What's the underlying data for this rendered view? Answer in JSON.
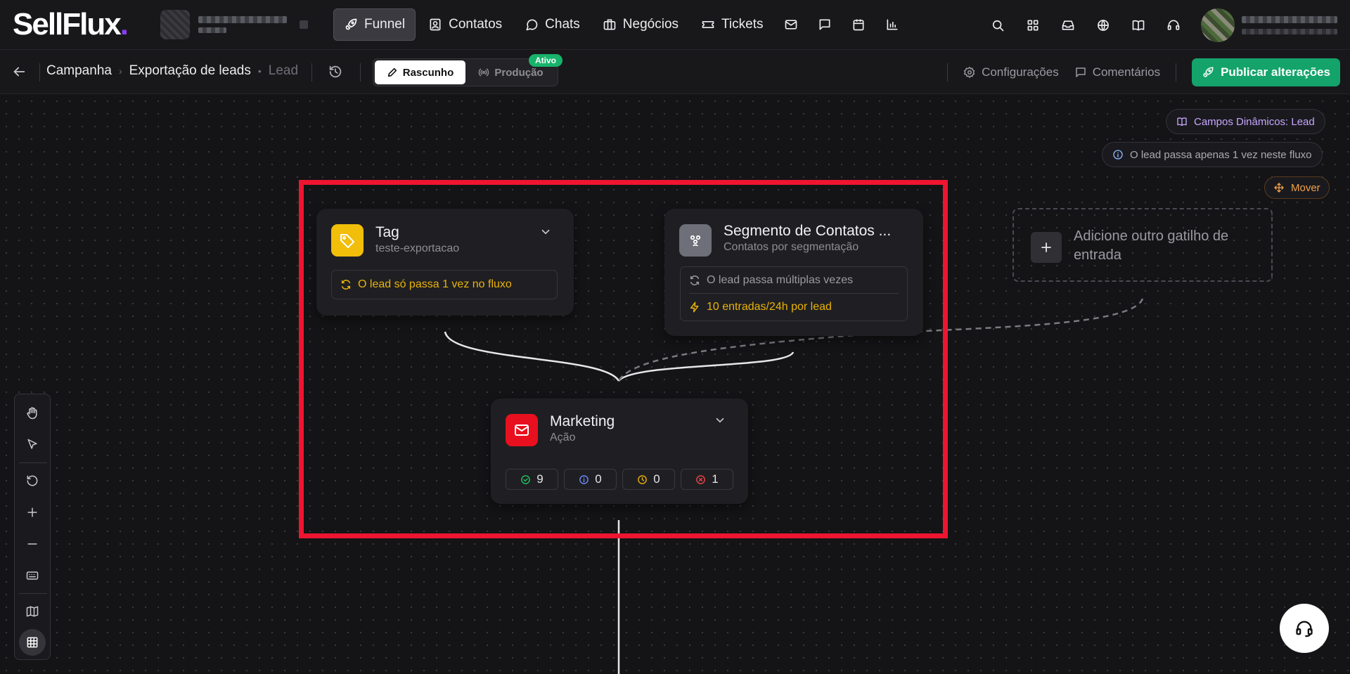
{
  "brand": {
    "logo": "SellFlux",
    "accent": "#8b3cf0"
  },
  "nav": {
    "items": [
      {
        "label": "Funnel",
        "icon": "rocket-icon",
        "active": true
      },
      {
        "label": "Contatos",
        "icon": "contacts-icon"
      },
      {
        "label": "Chats",
        "icon": "chat-icon"
      },
      {
        "label": "Negócios",
        "icon": "briefcase-icon"
      },
      {
        "label": "Tickets",
        "icon": "ticket-icon"
      }
    ],
    "icon_buttons": [
      "mail-icon",
      "message-icon",
      "calendar-icon",
      "bar-chart-icon"
    ]
  },
  "top_right_icons": [
    "search-icon",
    "apps-grid-icon",
    "inbox-icon",
    "globe-icon",
    "book-icon",
    "headset-icon"
  ],
  "breadcrumb": {
    "items": [
      "Campanha",
      "Exportação de leads"
    ],
    "current": "Lead"
  },
  "modes": {
    "draft": "Rascunho",
    "production": "Produção",
    "production_badge": "Ativo"
  },
  "actions": {
    "settings": "Configurações",
    "comments": "Comentários",
    "publish": "Publicar alterações"
  },
  "colors": {
    "publish": "#14a36a",
    "badge": "#18b36b",
    "highlight": "#ee1530",
    "warning": "#eab308",
    "marketing": "#e8101e"
  },
  "canvas": {
    "dynamic_fields": "Campos Dinâmicos: Lead",
    "flow_info": "O lead passa apenas 1 vez neste fluxo",
    "mover": "Mover",
    "add_trigger": "Adicione outro gatilho de entrada"
  },
  "nodes": {
    "tag": {
      "title": "Tag",
      "subtitle": "teste-exportacao",
      "info": "O lead só passa 1 vez no fluxo"
    },
    "segment": {
      "title": "Segmento de Contatos ...",
      "subtitle": "Contatos por segmentação",
      "info_1": "O lead passa múltiplas vezes",
      "info_2": "10 entradas/24h por lead"
    },
    "marketing": {
      "title": "Marketing",
      "subtitle": "Ação",
      "stats": [
        "9",
        "0",
        "0",
        "1"
      ]
    }
  },
  "toolbar": [
    "hand-icon",
    "pointer-icon",
    "undo-icon",
    "zoom-in-icon",
    "zoom-out-icon",
    "keyboard-icon",
    "map-icon",
    "grid-icon"
  ]
}
